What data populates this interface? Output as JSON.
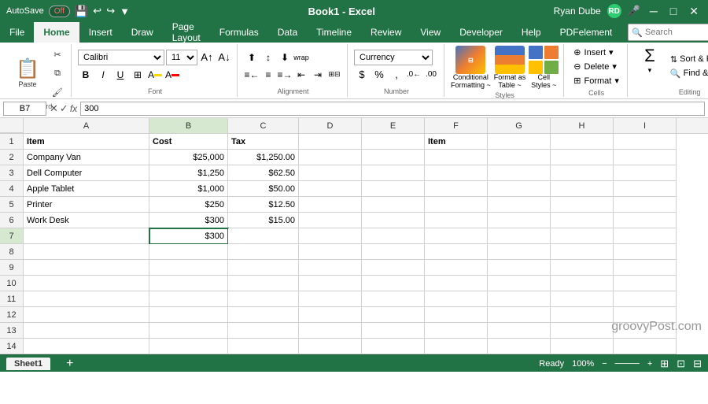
{
  "titleBar": {
    "autosave": "AutoSave",
    "autosaveState": "Off",
    "title": "Book1 - Excel",
    "userName": "Ryan Dube",
    "userInitials": "RD"
  },
  "menuTabs": [
    {
      "label": "File",
      "active": false
    },
    {
      "label": "Home",
      "active": true
    },
    {
      "label": "Insert",
      "active": false
    },
    {
      "label": "Draw",
      "active": false
    },
    {
      "label": "Page Layout",
      "active": false
    },
    {
      "label": "Formulas",
      "active": false
    },
    {
      "label": "Data",
      "active": false
    },
    {
      "label": "Timeline",
      "active": false
    },
    {
      "label": "Review",
      "active": false
    },
    {
      "label": "View",
      "active": false
    },
    {
      "label": "Developer",
      "active": false
    },
    {
      "label": "Help",
      "active": false
    },
    {
      "label": "PDFelement",
      "active": false
    }
  ],
  "ribbon": {
    "groups": [
      {
        "label": "Clipboard"
      },
      {
        "label": "Font"
      },
      {
        "label": "Alignment"
      },
      {
        "label": "Number"
      },
      {
        "label": "Styles"
      },
      {
        "label": "Cells"
      },
      {
        "label": "Editing"
      }
    ],
    "fontName": "Calibri",
    "fontSize": "11",
    "numberFormat": "Currency",
    "pasteLabel": "Paste",
    "insertLabel": "Insert",
    "deleteLabel": "Delete",
    "formatLabel": "Format",
    "conditionalFormattingLabel": "Conditional Formatting ~",
    "formatAsTableLabel": "Format as Table ~",
    "cellStylesLabel": "Cell Styles ~",
    "sumLabel": "Sum",
    "sortFilterLabel": "Sort & Filter ~",
    "findSelectLabel": "Find & Select ~",
    "searchPlaceholder": "Search"
  },
  "formulaBar": {
    "cellRef": "B7",
    "formulaContent": "300"
  },
  "columns": [
    {
      "label": "A",
      "width": "col-a"
    },
    {
      "label": "B",
      "width": "col-b"
    },
    {
      "label": "C",
      "width": "col-c"
    },
    {
      "label": "D",
      "width": "col-d"
    },
    {
      "label": "E",
      "width": "col-e"
    },
    {
      "label": "F",
      "width": "col-f"
    },
    {
      "label": "G",
      "width": "col-g"
    },
    {
      "label": "H",
      "width": "col-h"
    },
    {
      "label": "I",
      "width": "col-i"
    }
  ],
  "rows": [
    {
      "rowNum": "1",
      "cells": [
        {
          "col": "a",
          "value": "Item",
          "align": "left",
          "bold": true
        },
        {
          "col": "b",
          "value": "Cost",
          "align": "left",
          "bold": true
        },
        {
          "col": "c",
          "value": "Tax",
          "align": "left",
          "bold": true
        },
        {
          "col": "d",
          "value": ""
        },
        {
          "col": "e",
          "value": ""
        },
        {
          "col": "f",
          "value": "Item",
          "align": "left",
          "bold": true
        },
        {
          "col": "g",
          "value": ""
        },
        {
          "col": "h",
          "value": ""
        },
        {
          "col": "i",
          "value": ""
        }
      ]
    },
    {
      "rowNum": "2",
      "cells": [
        {
          "col": "a",
          "value": "Company Van",
          "align": "left"
        },
        {
          "col": "b",
          "value": "$25,000",
          "align": "right"
        },
        {
          "col": "c",
          "value": "$1,250.00",
          "align": "right"
        },
        {
          "col": "d",
          "value": ""
        },
        {
          "col": "e",
          "value": ""
        },
        {
          "col": "f",
          "value": ""
        },
        {
          "col": "g",
          "value": ""
        },
        {
          "col": "h",
          "value": ""
        },
        {
          "col": "i",
          "value": ""
        }
      ]
    },
    {
      "rowNum": "3",
      "cells": [
        {
          "col": "a",
          "value": "Dell Computer",
          "align": "left"
        },
        {
          "col": "b",
          "value": "$1,250",
          "align": "right"
        },
        {
          "col": "c",
          "value": "$62.50",
          "align": "right"
        },
        {
          "col": "d",
          "value": ""
        },
        {
          "col": "e",
          "value": ""
        },
        {
          "col": "f",
          "value": ""
        },
        {
          "col": "g",
          "value": ""
        },
        {
          "col": "h",
          "value": ""
        },
        {
          "col": "i",
          "value": ""
        }
      ]
    },
    {
      "rowNum": "4",
      "cells": [
        {
          "col": "a",
          "value": "Apple Tablet",
          "align": "left"
        },
        {
          "col": "b",
          "value": "$1,000",
          "align": "right"
        },
        {
          "col": "c",
          "value": "$50.00",
          "align": "right"
        },
        {
          "col": "d",
          "value": ""
        },
        {
          "col": "e",
          "value": ""
        },
        {
          "col": "f",
          "value": ""
        },
        {
          "col": "g",
          "value": ""
        },
        {
          "col": "h",
          "value": ""
        },
        {
          "col": "i",
          "value": ""
        }
      ]
    },
    {
      "rowNum": "5",
      "cells": [
        {
          "col": "a",
          "value": "Printer",
          "align": "left"
        },
        {
          "col": "b",
          "value": "$250",
          "align": "right"
        },
        {
          "col": "c",
          "value": "$12.50",
          "align": "right"
        },
        {
          "col": "d",
          "value": ""
        },
        {
          "col": "e",
          "value": ""
        },
        {
          "col": "f",
          "value": ""
        },
        {
          "col": "g",
          "value": ""
        },
        {
          "col": "h",
          "value": ""
        },
        {
          "col": "i",
          "value": ""
        }
      ]
    },
    {
      "rowNum": "6",
      "cells": [
        {
          "col": "a",
          "value": "Work Desk",
          "align": "left"
        },
        {
          "col": "b",
          "value": "$300",
          "align": "right"
        },
        {
          "col": "c",
          "value": "$15.00",
          "align": "right"
        },
        {
          "col": "d",
          "value": ""
        },
        {
          "col": "e",
          "value": ""
        },
        {
          "col": "f",
          "value": ""
        },
        {
          "col": "g",
          "value": ""
        },
        {
          "col": "h",
          "value": ""
        },
        {
          "col": "i",
          "value": ""
        }
      ]
    },
    {
      "rowNum": "7",
      "cells": [
        {
          "col": "a",
          "value": ""
        },
        {
          "col": "b",
          "value": "$300",
          "align": "right",
          "selected": true
        },
        {
          "col": "c",
          "value": ""
        },
        {
          "col": "d",
          "value": ""
        },
        {
          "col": "e",
          "value": ""
        },
        {
          "col": "f",
          "value": ""
        },
        {
          "col": "g",
          "value": ""
        },
        {
          "col": "h",
          "value": ""
        },
        {
          "col": "i",
          "value": ""
        }
      ]
    },
    {
      "rowNum": "8",
      "cells": [
        {
          "col": "a",
          "value": ""
        },
        {
          "col": "b",
          "value": ""
        },
        {
          "col": "c",
          "value": ""
        },
        {
          "col": "d",
          "value": ""
        },
        {
          "col": "e",
          "value": ""
        },
        {
          "col": "f",
          "value": ""
        },
        {
          "col": "g",
          "value": ""
        },
        {
          "col": "h",
          "value": ""
        },
        {
          "col": "i",
          "value": ""
        }
      ]
    },
    {
      "rowNum": "9",
      "cells": [
        {
          "col": "a",
          "value": ""
        },
        {
          "col": "b",
          "value": ""
        },
        {
          "col": "c",
          "value": ""
        },
        {
          "col": "d",
          "value": ""
        },
        {
          "col": "e",
          "value": ""
        },
        {
          "col": "f",
          "value": ""
        },
        {
          "col": "g",
          "value": ""
        },
        {
          "col": "h",
          "value": ""
        },
        {
          "col": "i",
          "value": ""
        }
      ]
    },
    {
      "rowNum": "10",
      "cells": [
        {
          "col": "a",
          "value": ""
        },
        {
          "col": "b",
          "value": ""
        },
        {
          "col": "c",
          "value": ""
        },
        {
          "col": "d",
          "value": ""
        },
        {
          "col": "e",
          "value": ""
        },
        {
          "col": "f",
          "value": ""
        },
        {
          "col": "g",
          "value": ""
        },
        {
          "col": "h",
          "value": ""
        },
        {
          "col": "i",
          "value": ""
        }
      ]
    },
    {
      "rowNum": "11",
      "cells": [
        {
          "col": "a",
          "value": ""
        },
        {
          "col": "b",
          "value": ""
        },
        {
          "col": "c",
          "value": ""
        },
        {
          "col": "d",
          "value": ""
        },
        {
          "col": "e",
          "value": ""
        },
        {
          "col": "f",
          "value": ""
        },
        {
          "col": "g",
          "value": ""
        },
        {
          "col": "h",
          "value": ""
        },
        {
          "col": "i",
          "value": ""
        }
      ]
    },
    {
      "rowNum": "12",
      "cells": [
        {
          "col": "a",
          "value": ""
        },
        {
          "col": "b",
          "value": ""
        },
        {
          "col": "c",
          "value": ""
        },
        {
          "col": "d",
          "value": ""
        },
        {
          "col": "e",
          "value": ""
        },
        {
          "col": "f",
          "value": ""
        },
        {
          "col": "g",
          "value": ""
        },
        {
          "col": "h",
          "value": ""
        },
        {
          "col": "i",
          "value": ""
        }
      ]
    },
    {
      "rowNum": "13",
      "cells": [
        {
          "col": "a",
          "value": ""
        },
        {
          "col": "b",
          "value": ""
        },
        {
          "col": "c",
          "value": ""
        },
        {
          "col": "d",
          "value": ""
        },
        {
          "col": "e",
          "value": ""
        },
        {
          "col": "f",
          "value": ""
        },
        {
          "col": "g",
          "value": ""
        },
        {
          "col": "h",
          "value": ""
        },
        {
          "col": "i",
          "value": ""
        }
      ]
    },
    {
      "rowNum": "14",
      "cells": [
        {
          "col": "a",
          "value": ""
        },
        {
          "col": "b",
          "value": ""
        },
        {
          "col": "c",
          "value": ""
        },
        {
          "col": "d",
          "value": ""
        },
        {
          "col": "e",
          "value": ""
        },
        {
          "col": "f",
          "value": ""
        },
        {
          "col": "g",
          "value": ""
        },
        {
          "col": "h",
          "value": ""
        },
        {
          "col": "i",
          "value": ""
        }
      ]
    }
  ],
  "statusBar": {
    "sheetTab": "Sheet1",
    "readyLabel": "Ready",
    "zoomLevel": "100%"
  },
  "watermark": "groovyPost.com"
}
